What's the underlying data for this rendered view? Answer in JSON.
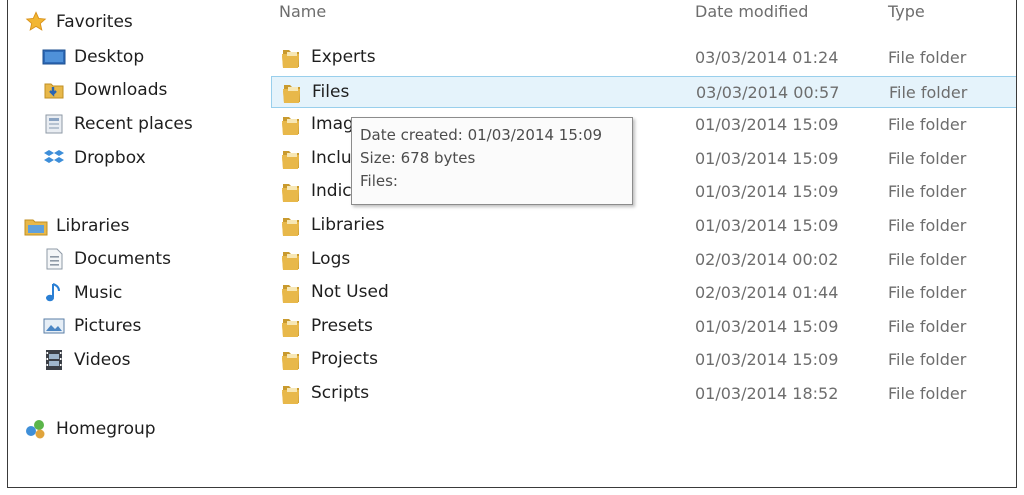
{
  "sidebar": {
    "favorites": {
      "label": "Favorites",
      "icon": "star-icon"
    },
    "favorite_items": [
      {
        "label": "Desktop",
        "icon": "desktop-icon"
      },
      {
        "label": "Downloads",
        "icon": "downloads-icon"
      },
      {
        "label": "Recent places",
        "icon": "recent-places-icon"
      },
      {
        "label": "Dropbox",
        "icon": "dropbox-icon"
      }
    ],
    "libraries": {
      "label": "Libraries",
      "icon": "libraries-icon"
    },
    "library_items": [
      {
        "label": "Documents",
        "icon": "documents-icon"
      },
      {
        "label": "Music",
        "icon": "music-icon"
      },
      {
        "label": "Pictures",
        "icon": "pictures-icon"
      },
      {
        "label": "Videos",
        "icon": "videos-icon"
      }
    ],
    "homegroup": {
      "label": "Homegroup",
      "icon": "homegroup-icon"
    }
  },
  "columns": {
    "name": "Name",
    "date_modified": "Date modified",
    "type": "Type"
  },
  "files": [
    {
      "name": "Experts",
      "date": "03/03/2014 01:24",
      "type": "File folder"
    },
    {
      "name": "Files",
      "date": "03/03/2014 00:57",
      "type": "File folder",
      "selected": true
    },
    {
      "name": "Imag",
      "date": "01/03/2014 15:09",
      "type": "File folder"
    },
    {
      "name": "Inclu",
      "date": "01/03/2014 15:09",
      "type": "File folder"
    },
    {
      "name": "Indic",
      "date": "01/03/2014 15:09",
      "type": "File folder"
    },
    {
      "name": "Libraries",
      "date": "01/03/2014 15:09",
      "type": "File folder"
    },
    {
      "name": "Logs",
      "date": "02/03/2014 00:02",
      "type": "File folder"
    },
    {
      "name": "Not Used",
      "date": "02/03/2014 01:44",
      "type": "File folder"
    },
    {
      "name": "Presets",
      "date": "01/03/2014 15:09",
      "type": "File folder"
    },
    {
      "name": "Projects",
      "date": "01/03/2014 15:09",
      "type": "File folder"
    },
    {
      "name": "Scripts",
      "date": "01/03/2014 18:52",
      "type": "File folder"
    }
  ],
  "tooltip": {
    "date_created": "Date created: 01/03/2014 15:09",
    "size": "Size: 678 bytes",
    "files": "Files:"
  },
  "colors": {
    "selection_bg": "#e5f3fb",
    "selection_border": "#99cfec",
    "folder": "#e8b84a"
  }
}
